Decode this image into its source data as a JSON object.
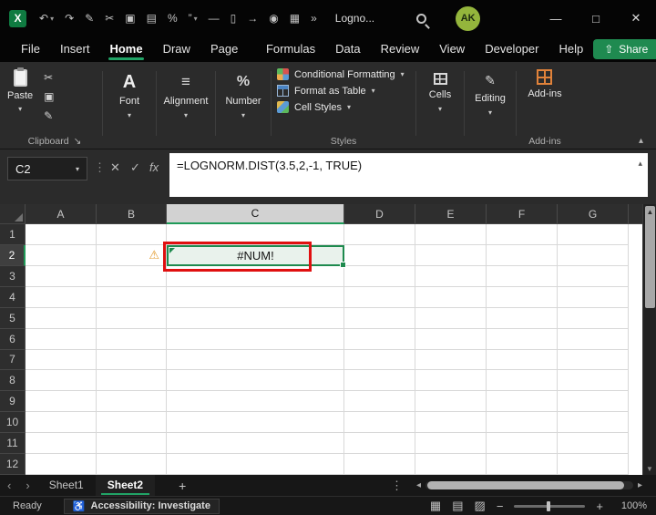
{
  "titlebar": {
    "title": "Logno...",
    "avatar_initials": "AK"
  },
  "icons": {
    "logo_letter": "X",
    "q_undo": "↶",
    "q_redo": "↷",
    "q_painter": "✎",
    "q_cut": "✂",
    "q_copy": "▣",
    "q_paste": "▤",
    "q_percent": "%",
    "q_quote": "”",
    "q_dash": "—",
    "q_doc": "▯",
    "q_goto": "→",
    "q_camera": "◉",
    "q_table": "▦",
    "q_more": "»",
    "chevron_down": "▾",
    "collapse_up": "▴",
    "win_min": "—",
    "win_max": "□",
    "win_close": "✕",
    "dots": "⋮",
    "cancel": "✕",
    "enter": "✓",
    "fx": "fx",
    "dialog_launcher": "↘",
    "font_glyph": "A",
    "alignment_glyph": "≡",
    "number_glyph": "%",
    "editing_glyph": "✎",
    "share_arrow": "⇧",
    "warning": "⚠",
    "nav_prev": "‹",
    "nav_next": "›",
    "scroll_left": "◂",
    "scroll_right": "▸",
    "scroll_up": "▲",
    "scroll_down": "▼",
    "view_normal": "▦",
    "view_layout": "▤",
    "view_break": "▨",
    "zoom_out": "−",
    "zoom_in": "+",
    "accessibility": "♿"
  },
  "menu": {
    "tabs": [
      "File",
      "Insert",
      "Home",
      "Draw",
      "Page Layout",
      "Formulas",
      "Data",
      "Review",
      "View",
      "Developer",
      "Help"
    ],
    "active_tab": "Home",
    "share_label": "Share"
  },
  "ribbon": {
    "paste_label": "Paste",
    "clipboard_group": "Clipboard",
    "font_label": "Font",
    "alignment_label": "Alignment",
    "number_label": "Number",
    "conditional_formatting": "Conditional Formatting",
    "format_as_table": "Format as Table",
    "cell_styles": "Cell Styles",
    "styles_group": "Styles",
    "cells_label": "Cells",
    "editing_label": "Editing",
    "addins_label": "Add-ins",
    "addins_group": "Add-ins"
  },
  "formula_bar": {
    "name_box": "C2",
    "formula": "=LOGNORM.DIST(3.5,2,-1, TRUE)"
  },
  "grid": {
    "columns": [
      "A",
      "B",
      "C",
      "D",
      "E",
      "F",
      "G"
    ],
    "rows": [
      "1",
      "2",
      "3",
      "4",
      "5",
      "6",
      "7",
      "8",
      "9",
      "10",
      "11",
      "12"
    ],
    "selected_column": "C",
    "selected_row": "2",
    "active_cell": "C2",
    "cell_value": "#NUM!",
    "warning_cell": "B2"
  },
  "sheetbar": {
    "sheets": [
      "Sheet1",
      "Sheet2"
    ],
    "active_sheet": "Sheet2",
    "add_label": "+"
  },
  "statusbar": {
    "ready": "Ready",
    "accessibility_text": "Accessibility: Investigate",
    "zoom_value": "100%"
  },
  "colors": {
    "accent_green": "#21a366",
    "selection_green": "#1e8a4e",
    "annotation_red": "#e01010",
    "addin_orange": "#e0823a",
    "cell_fill": "#e9f2ec"
  }
}
